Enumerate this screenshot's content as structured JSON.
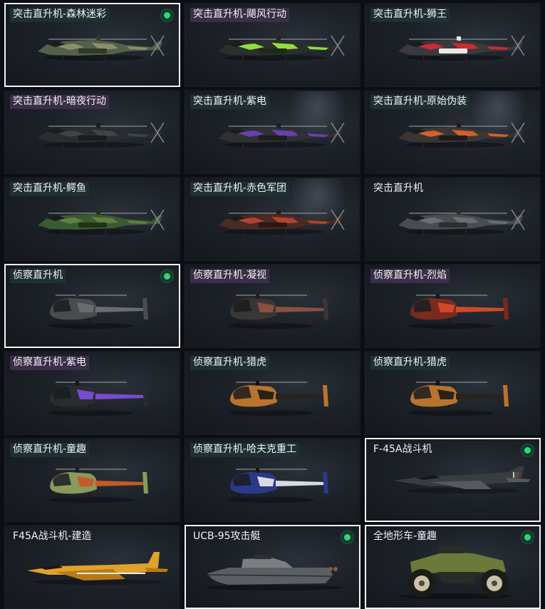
{
  "vehicles": [
    {
      "label": "突击直升机-森林迷彩",
      "tag": "t-dark",
      "kind": "attack",
      "selected": true,
      "equipped": true,
      "c1": "#55604a",
      "c2": "#8a8f6e",
      "accent": "#2f3a28"
    },
    {
      "label": "突击直升机-飓风行动",
      "tag": "t-purple",
      "kind": "attack",
      "selected": false,
      "equipped": false,
      "c1": "#2c2f2c",
      "c2": "#8fe03a",
      "accent": "#1e2a16"
    },
    {
      "label": "突击直升机-狮王",
      "tag": "t-dark",
      "kind": "attack",
      "selected": false,
      "equipped": false,
      "c1": "#3a3a3e",
      "c2": "#d02a30",
      "accent": "#e8e8e8"
    },
    {
      "label": "突击直升机-暗夜行动",
      "tag": "t-purple",
      "kind": "attack",
      "selected": false,
      "equipped": false,
      "c1": "#2a2d2f",
      "c2": "#3f4448",
      "accent": "#1a1c1e"
    },
    {
      "label": "突击直升机-紫电",
      "tag": "t-dark",
      "kind": "attack",
      "selected": false,
      "equipped": false,
      "c1": "#2e3133",
      "c2": "#6c3fb0",
      "accent": "#1c1e20"
    },
    {
      "label": "突击直升机-原始伪装",
      "tag": "t-dark",
      "kind": "attack",
      "selected": false,
      "equipped": false,
      "c1": "#3a3634",
      "c2": "#d2612a",
      "accent": "#1e1b1a"
    },
    {
      "label": "突击直升机-鳄鱼",
      "tag": "t-dark",
      "kind": "attack",
      "selected": false,
      "equipped": false,
      "c1": "#3c5a30",
      "c2": "#5f7f45",
      "accent": "#22331b"
    },
    {
      "label": "突击直升机-赤色军团",
      "tag": "t-dark",
      "kind": "attack",
      "selected": false,
      "equipped": false,
      "c1": "#4a2a22",
      "c2": "#b2432e",
      "accent": "#2a1814"
    },
    {
      "label": "突击直升机",
      "tag": "t-none",
      "kind": "attack",
      "selected": false,
      "equipped": false,
      "c1": "#4a4d50",
      "c2": "#6a6e72",
      "accent": "#2c2e30"
    },
    {
      "label": "侦察直升机",
      "tag": "t-dark",
      "kind": "scout",
      "selected": true,
      "equipped": true,
      "c1": "#4a4c4f",
      "c2": "#6a6d70",
      "accent": "#2a2c2e"
    },
    {
      "label": "侦察直升机-凝视",
      "tag": "t-purple",
      "kind": "scout",
      "selected": false,
      "equipped": false,
      "c1": "#3a3634",
      "c2": "#8a5040",
      "accent": "#201e1d"
    },
    {
      "label": "侦察直升机-烈焰",
      "tag": "t-purple",
      "kind": "scout",
      "selected": false,
      "equipped": false,
      "c1": "#7a2a1e",
      "c2": "#d0482a",
      "accent": "#1e1514"
    },
    {
      "label": "侦察直升机-紫电",
      "tag": "t-purple",
      "kind": "scout",
      "selected": false,
      "equipped": false,
      "c1": "#2a2d30",
      "c2": "#7a4ad0",
      "accent": "#15171a"
    },
    {
      "label": "侦察直升机-猎虎",
      "tag": "t-dark",
      "kind": "scout",
      "selected": false,
      "equipped": false,
      "c1": "#b8742e",
      "c2": "#2a221a",
      "accent": "#141210"
    },
    {
      "label": "侦察直升机-猎虎",
      "tag": "t-dark",
      "kind": "scout",
      "selected": false,
      "equipped": false,
      "c1": "#b8742e",
      "c2": "#2a221a",
      "accent": "#141210"
    },
    {
      "label": "侦察直升机-童趣",
      "tag": "t-dark",
      "kind": "scout",
      "selected": false,
      "equipped": false,
      "c1": "#8a9a5a",
      "c2": "#c45a2a",
      "accent": "#1a1c16"
    },
    {
      "label": "侦察直升机-哈夫克重工",
      "tag": "t-dark",
      "kind": "scout",
      "selected": false,
      "equipped": false,
      "c1": "#2a3a8a",
      "c2": "#d8dbe4",
      "accent": "#141622"
    },
    {
      "label": "F-45A战斗机",
      "tag": "t-none",
      "kind": "jet",
      "selected": true,
      "equipped": true,
      "c1": "#3a3d40",
      "c2": "#555a5e",
      "accent": "#24272a"
    },
    {
      "label": "F45A战斗机-建造",
      "tag": "t-none",
      "kind": "jet2",
      "selected": false,
      "equipped": false,
      "c1": "#e0a22a",
      "c2": "#b87a18",
      "accent": "#2a2218"
    },
    {
      "label": "UCB-95攻击艇",
      "tag": "t-none",
      "kind": "boat",
      "selected": true,
      "equipped": true,
      "c1": "#5a5f63",
      "c2": "#7a7f83",
      "accent": "#2c2f32"
    },
    {
      "label": "全地形车-童趣",
      "tag": "t-none",
      "kind": "atv",
      "selected": true,
      "equipped": true,
      "c1": "#6a7a3a",
      "c2": "#c9c2a6",
      "accent": "#1a1c18"
    }
  ]
}
